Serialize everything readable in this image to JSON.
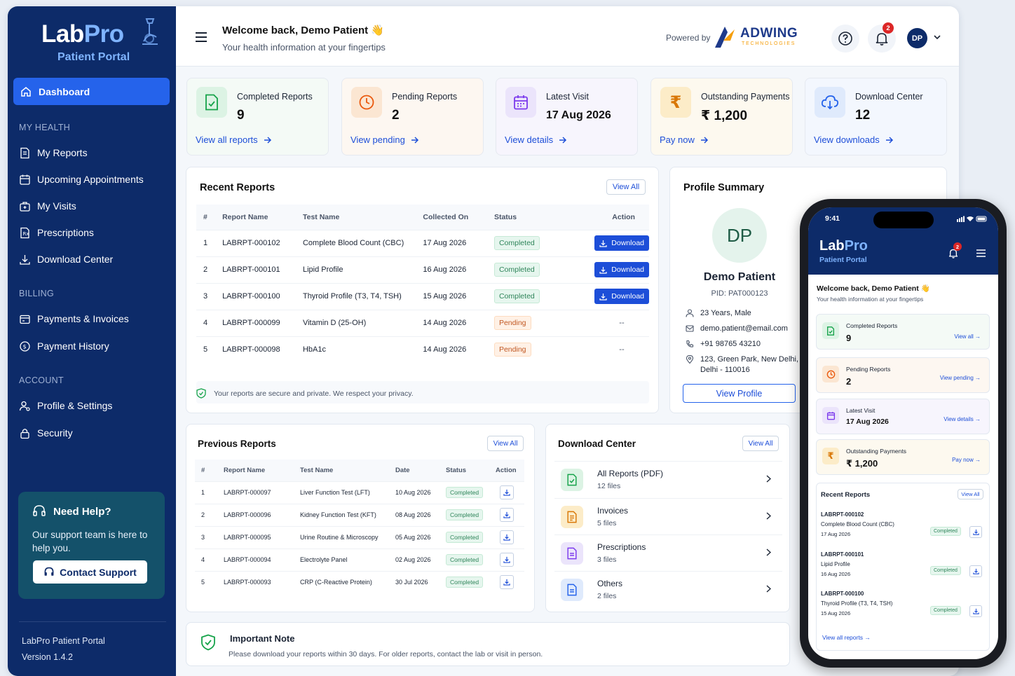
{
  "brand": {
    "name_lab": "Lab",
    "name_pro": "Pro",
    "subtitle": "Patient Portal"
  },
  "sidebar": {
    "dashboard": "Dashboard",
    "sections": {
      "health": "MY HEALTH",
      "billing": "BILLING",
      "account": "ACCOUNT"
    },
    "health_items": [
      "My Reports",
      "Upcoming Appointments",
      "My Visits",
      "Prescriptions",
      "Download Center"
    ],
    "billing_items": [
      "Payments & Invoices",
      "Payment History"
    ],
    "account_items": [
      "Profile & Settings",
      "Security"
    ],
    "help": {
      "title": "Need Help?",
      "text": "Our support team is here to help you.",
      "button": "Contact Support"
    },
    "footer": {
      "portal": "LabPro Patient Portal",
      "version": "Version 1.4.2"
    }
  },
  "header": {
    "welcome": "Welcome back, Demo Patient 👋",
    "subtitle": "Your health information at your fingertips",
    "powered_by": "Powered by",
    "partner": "ADWING",
    "partner_sub": "TECHNOLOGIES",
    "notification_count": "2",
    "avatar": "DP"
  },
  "stats": [
    {
      "label": "Completed Reports",
      "value": "9",
      "link": "View all reports",
      "icon": "report-check-icon",
      "color": "#16a34a"
    },
    {
      "label": "Pending Reports",
      "value": "2",
      "link": "View pending",
      "icon": "clock-icon",
      "color": "#ea580c"
    },
    {
      "label": "Latest Visit",
      "value": "17 Aug 2026",
      "link": "View details",
      "icon": "calendar-icon",
      "color": "#7c3aed"
    },
    {
      "label": "Outstanding Payments",
      "value": "₹ 1,200",
      "link": "Pay now",
      "icon": "rupee-icon",
      "color": "#d97706"
    },
    {
      "label": "Download Center",
      "value": "12",
      "link": "View downloads",
      "icon": "cloud-download-icon",
      "color": "#2563eb"
    }
  ],
  "recent": {
    "title": "Recent Reports",
    "view_all": "View All",
    "columns": [
      "#",
      "Report Name",
      "Test Name",
      "Collected On",
      "Status",
      "Action"
    ],
    "rows": [
      {
        "n": "1",
        "id": "LABRPT-000102",
        "test": "Complete Blood Count (CBC)",
        "date": "17 Aug 2026",
        "status": "Completed",
        "action": "Download"
      },
      {
        "n": "2",
        "id": "LABRPT-000101",
        "test": "Lipid Profile",
        "date": "16 Aug 2026",
        "status": "Completed",
        "action": "Download"
      },
      {
        "n": "3",
        "id": "LABRPT-000100",
        "test": "Thyroid Profile (T3, T4, TSH)",
        "date": "15 Aug 2026",
        "status": "Completed",
        "action": "Download"
      },
      {
        "n": "4",
        "id": "LABRPT-000099",
        "test": "Vitamin D (25-OH)",
        "date": "14 Aug 2026",
        "status": "Pending",
        "action": "--"
      },
      {
        "n": "5",
        "id": "LABRPT-000098",
        "test": "HbA1c",
        "date": "14 Aug 2026",
        "status": "Pending",
        "action": "--"
      }
    ],
    "secure_note": "Your reports are secure and private. We respect your privacy."
  },
  "profile": {
    "title": "Profile Summary",
    "initials": "DP",
    "name": "Demo Patient",
    "pid": "PID: PAT000123",
    "age": "23 Years, Male",
    "email": "demo.patient@email.com",
    "phone": "+91 98765 43210",
    "address_1": "123, Green Park, New Delhi,",
    "address_2": "Delhi - 110016",
    "button": "View Profile"
  },
  "previous": {
    "title": "Previous Reports",
    "view_all": "View All",
    "columns": [
      "#",
      "Report Name",
      "Test Name",
      "Date",
      "Status",
      "Action"
    ],
    "rows": [
      {
        "n": "1",
        "id": "LABRPT-000097",
        "test": "Liver Function Test (LFT)",
        "date": "10 Aug 2026",
        "status": "Completed"
      },
      {
        "n": "2",
        "id": "LABRPT-000096",
        "test": "Kidney Function Test (KFT)",
        "date": "08 Aug 2026",
        "status": "Completed"
      },
      {
        "n": "3",
        "id": "LABRPT-000095",
        "test": "Urine Routine & Microscopy",
        "date": "05 Aug 2026",
        "status": "Completed"
      },
      {
        "n": "4",
        "id": "LABRPT-000094",
        "test": "Electrolyte Panel",
        "date": "02 Aug 2026",
        "status": "Completed"
      },
      {
        "n": "5",
        "id": "LABRPT-000093",
        "test": "CRP (C-Reactive Protein)",
        "date": "30 Jul 2026",
        "status": "Completed"
      }
    ]
  },
  "downloads": {
    "title": "Download Center",
    "view_all": "View All",
    "items": [
      {
        "name": "All Reports (PDF)",
        "count": "12 files",
        "color": "#16a34a"
      },
      {
        "name": "Invoices",
        "count": "5 files",
        "color": "#d97706"
      },
      {
        "name": "Prescriptions",
        "count": "3 files",
        "color": "#7c3aed"
      },
      {
        "name": "Others",
        "count": "2 files",
        "color": "#2563eb"
      }
    ]
  },
  "note": {
    "title": "Important Note",
    "text": "Please download your reports within 30 days. For older reports, contact the lab or visit in person."
  },
  "mobile": {
    "time": "9:41",
    "badge": "2",
    "welcome": "Welcome back, Demo Patient 👋",
    "subtitle": "Your health information at your fingertips",
    "cards": [
      {
        "label": "Completed Reports",
        "value": "9",
        "link": "View all →"
      },
      {
        "label": "Pending Reports",
        "value": "2",
        "link": "View pending →"
      },
      {
        "label": "Latest Visit",
        "value": "17 Aug 2026",
        "link": "View details →"
      },
      {
        "label": "Outstanding Payments",
        "value": "₹ 1,200",
        "link": "Pay now →"
      }
    ],
    "recent_title": "Recent Reports",
    "view_all": "View All",
    "items": [
      {
        "id": "LABRPT-000102",
        "test": "Complete Blood Count (CBC)",
        "date": "17 Aug 2026",
        "status": "Completed"
      },
      {
        "id": "LABRPT-000101",
        "test": "Lipid Profile",
        "date": "16 Aug 2026",
        "status": "Completed"
      },
      {
        "id": "LABRPT-000100",
        "test": "Thyroid Profile (T3, T4, TSH)",
        "date": "15 Aug 2026",
        "status": "Completed"
      }
    ],
    "footer_link": "View all reports →"
  }
}
